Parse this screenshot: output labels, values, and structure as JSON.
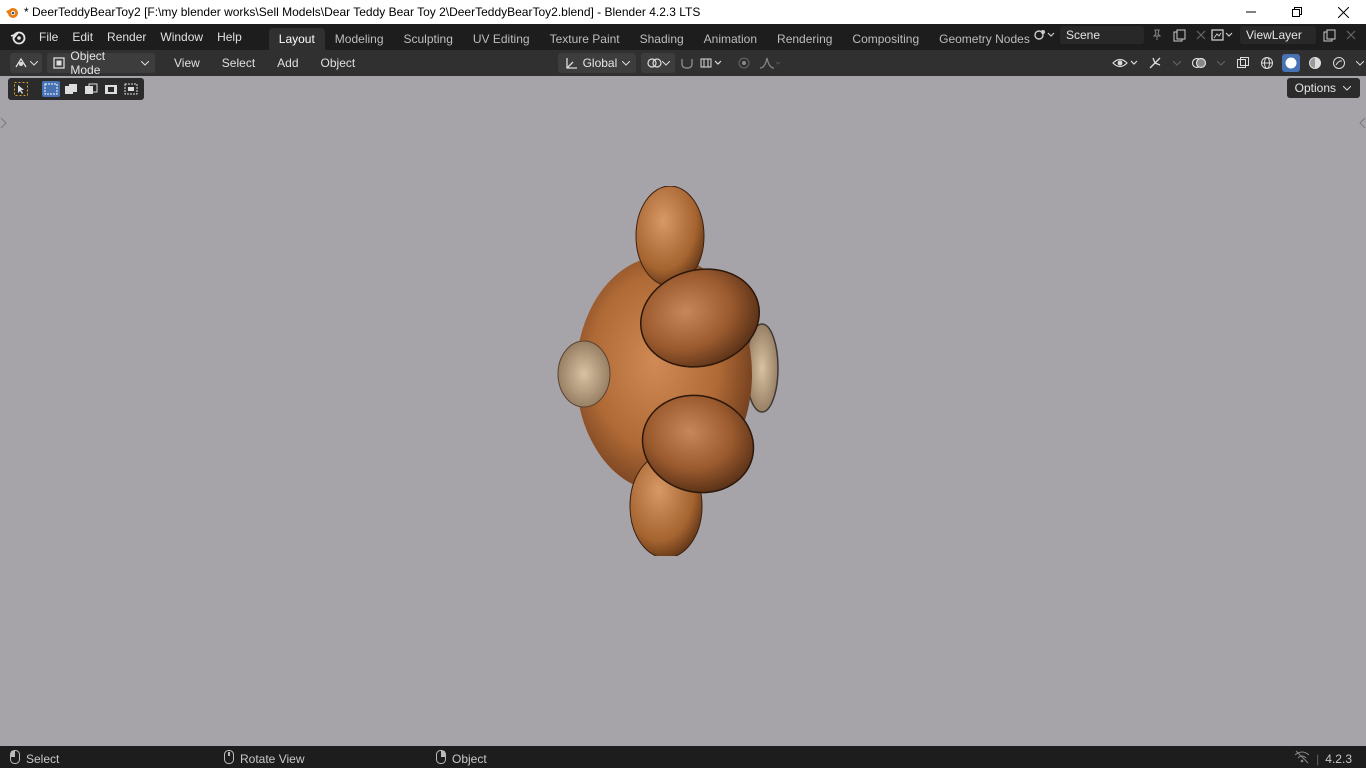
{
  "window": {
    "title": "* DeerTeddyBearToy2 [F:\\my blender works\\Sell Models\\Dear Teddy Bear Toy 2\\DeerTeddyBearToy2.blend] - Blender 4.2.3 LTS",
    "controls": [
      "minimize-icon",
      "restore-icon",
      "close-icon"
    ]
  },
  "menu": {
    "items": [
      "File",
      "Edit",
      "Render",
      "Window",
      "Help"
    ]
  },
  "workspaces": {
    "tabs": [
      "Layout",
      "Modeling",
      "Sculpting",
      "UV Editing",
      "Texture Paint",
      "Shading",
      "Animation",
      "Rendering",
      "Compositing",
      "Geometry Nodes"
    ],
    "active": "Layout"
  },
  "scene": {
    "name": "Scene"
  },
  "view_layer": {
    "name": "ViewLayer"
  },
  "viewport_header": {
    "mode": "Object Mode",
    "menus": [
      "View",
      "Select",
      "Add",
      "Object"
    ],
    "transform_orientation": "Global"
  },
  "viewport": {
    "options_label": "Options",
    "background_color": "#a7a4a9",
    "object": "teddy bear model"
  },
  "statusbar": {
    "left_click": "Select",
    "middle_click": "Rotate View",
    "right_click": "Object",
    "version": "4.2.3"
  },
  "colors": {
    "topbar": "#1d1d1d",
    "header": "#303030",
    "accent": "#4772b3"
  }
}
